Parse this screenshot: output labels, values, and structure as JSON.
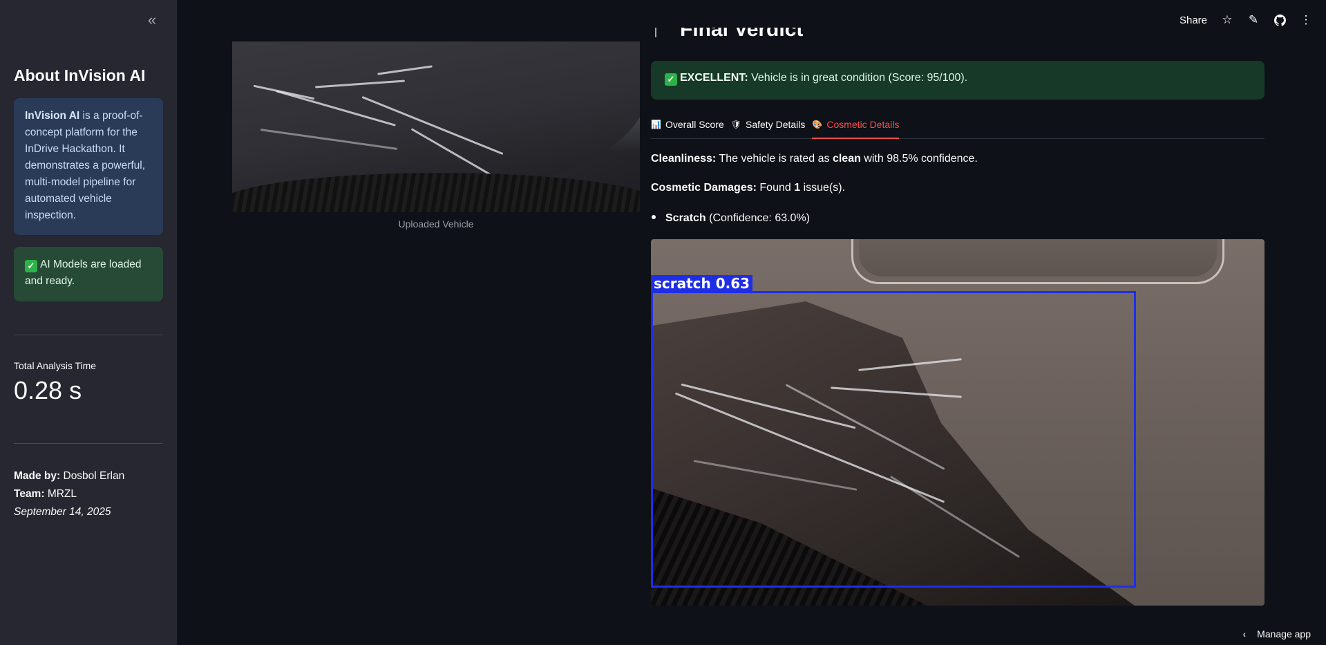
{
  "sidebar": {
    "collapse_icon": "chevron-double-left-icon",
    "title": "About InVision AI",
    "info": {
      "brand": "InVision AI",
      "text": " is a proof-of-concept platform for the InDrive Hackathon. It demonstrates a powerful, multi-model pipeline for automated vehicle inspection."
    },
    "status": "AI Models are loaded and ready.",
    "metric": {
      "label": "Total Analysis Time",
      "value": "0.28 s"
    },
    "credits": {
      "made_by_label": "Made by:",
      "made_by": " Dosbol Erlan",
      "team_label": "Team:",
      "team": " MRZL",
      "date": "September 14, 2025"
    }
  },
  "topbar": {
    "share": "Share"
  },
  "left_panel": {
    "caption": "Uploaded Vehicle"
  },
  "verdict": {
    "title": "Final Verdict",
    "label": "EXCELLENT:",
    "text": " Vehicle is in great condition (Score: 95/100)."
  },
  "tabs": [
    {
      "label": "Overall Score",
      "icon": "bar-chart-icon"
    },
    {
      "label": "Safety Details",
      "icon": "shield-icon"
    },
    {
      "label": "Cosmetic Details",
      "icon": "paint-icon",
      "active": true
    }
  ],
  "cosmetic": {
    "cleanliness_label": "Cleanliness:",
    "cleanliness_pre": " The vehicle is rated as ",
    "cleanliness_value": "clean",
    "cleanliness_post": " with 98.5% confidence.",
    "damages_label": "Cosmetic Damages:",
    "damages_pre": " Found ",
    "damages_count": "1",
    "damages_post": " issue(s).",
    "items": [
      {
        "name": "Scratch",
        "confidence": " (Confidence: 63.0%)"
      }
    ],
    "detection_label": "scratch  0.63"
  },
  "footer": {
    "manage": "Manage app"
  },
  "colors": {
    "accent": "#ff4b4b",
    "bbox": "#1f2ee6",
    "success_bg": "#173928",
    "info_bg": "#2a3b57"
  }
}
